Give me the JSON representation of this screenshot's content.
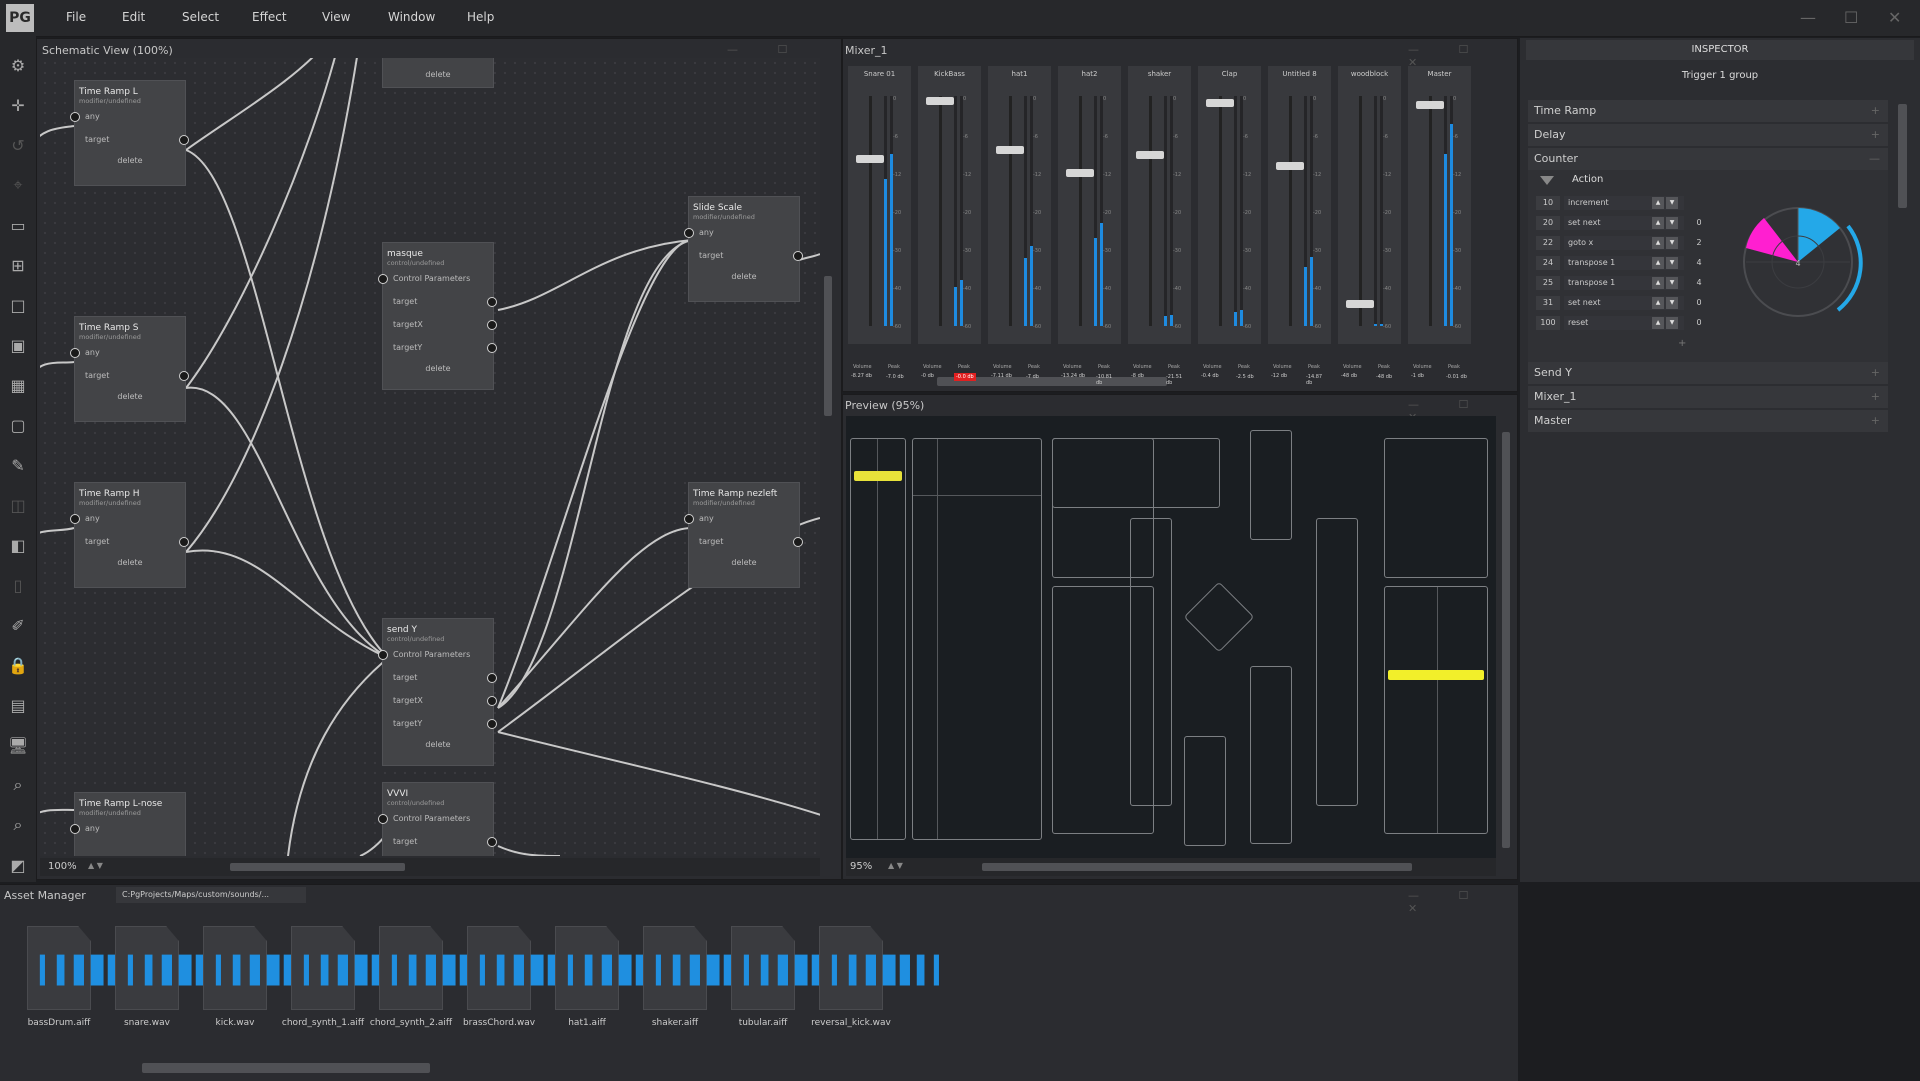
{
  "app": {
    "logo": "PG"
  },
  "menu": [
    "File",
    "Edit",
    "Select",
    "Effect",
    "View",
    "Window",
    "Help"
  ],
  "window_buttons": [
    "—",
    "☐",
    "✕"
  ],
  "toolbar_icons": [
    "gear-icon",
    "crosshair-icon",
    "undo-icon",
    "redo-icon",
    "folder-icon",
    "add-box-icon",
    "square-icon",
    "image-icon",
    "grid-icon",
    "frame-icon",
    "edit-icon",
    "layers-icon",
    "stack-icon",
    "phone-icon",
    "pen-icon",
    "lock-icon",
    "lock-box-icon",
    "monitor-icon",
    "zoom-in-icon",
    "zoom-out-icon",
    "layers-alt-icon"
  ],
  "schematic": {
    "title": "Schematic View (100%)",
    "zoom": "100%",
    "nodes": [
      {
        "id": "tr-l",
        "title": "Time Ramp L",
        "sub": "modifier/undefined",
        "ports": [
          "any",
          "target"
        ],
        "del": "delete"
      },
      {
        "id": "tr-s",
        "title": "Time Ramp S",
        "sub": "modifier/undefined",
        "ports": [
          "any",
          "target"
        ],
        "del": "delete"
      },
      {
        "id": "tr-h",
        "title": "Time Ramp H",
        "sub": "modifier/undefined",
        "ports": [
          "any",
          "target"
        ],
        "del": "delete"
      },
      {
        "id": "tr-lnose",
        "title": "Time Ramp L-nose",
        "sub": "modifier/undefined",
        "ports": [
          "any"
        ],
        "del": ""
      },
      {
        "id": "top",
        "title": "",
        "sub": "",
        "ports": [],
        "del": "delete"
      },
      {
        "id": "masque",
        "title": "masque",
        "sub": "control/undefined",
        "ports": [
          "Control Parameters",
          "target",
          "targetX",
          "targetY"
        ],
        "del": "delete"
      },
      {
        "id": "sendy",
        "title": "send Y",
        "sub": "control/undefined",
        "ports": [
          "Control Parameters",
          "target",
          "targetX",
          "targetY"
        ],
        "del": "delete"
      },
      {
        "id": "vvvi",
        "title": "VVVI",
        "sub": "control/undefined",
        "ports": [
          "Control Parameters",
          "target"
        ],
        "del": ""
      },
      {
        "id": "slide",
        "title": "Slide Scale",
        "sub": "modifier/undefined",
        "ports": [
          "any",
          "target"
        ],
        "del": "delete"
      },
      {
        "id": "trnez",
        "title": "Time Ramp nezleft",
        "sub": "modifier/undefined",
        "ports": [
          "any",
          "target"
        ],
        "del": "delete"
      }
    ]
  },
  "mixer": {
    "title": "Mixer_1",
    "scale": [
      "0",
      "-6",
      "-12",
      "-20",
      "-30",
      "-40",
      "-60"
    ],
    "label_volume": "Volume",
    "label_peak": "Peak",
    "strips": [
      {
        "name": "Snare 01",
        "vol": "-8.27 db",
        "peak": "-7.0 db",
        "fader": 0.28,
        "level": 0.75,
        "peak_red": false
      },
      {
        "name": "KickBass",
        "vol": "-0 db",
        "peak": "-0.0 db",
        "fader": 0.02,
        "level": 0.2,
        "peak_red": true
      },
      {
        "name": "hat1",
        "vol": "-7.11 db",
        "peak": "-7 db",
        "fader": 0.24,
        "level": 0.35,
        "peak_red": false
      },
      {
        "name": "hat2",
        "vol": "-13.24 db",
        "peak": "-10.81 db",
        "fader": 0.34,
        "level": 0.45,
        "peak_red": false
      },
      {
        "name": "shaker",
        "vol": "-8 db",
        "peak": "-21.51 db",
        "fader": 0.26,
        "level": 0.05,
        "peak_red": false
      },
      {
        "name": "Clap",
        "vol": "-0.4 db",
        "peak": "-2.5 db",
        "fader": 0.03,
        "level": 0.07,
        "peak_red": false
      },
      {
        "name": "Untitled 8",
        "vol": "-12 db",
        "peak": "-14.87 db",
        "fader": 0.31,
        "level": 0.3,
        "peak_red": false
      },
      {
        "name": "woodblock",
        "vol": "-48 db",
        "peak": "-48 db",
        "fader": 0.92,
        "level": 0.01,
        "peak_red": false
      },
      {
        "name": "Master",
        "vol": "-1 db",
        "peak": "-0.01 db",
        "fader": 0.04,
        "level": 0.88,
        "peak_red": false
      }
    ]
  },
  "preview": {
    "title": "Preview (95%)",
    "zoom": "95%"
  },
  "inspector": {
    "title": "INSPECTOR",
    "group": "Trigger 1 group",
    "sections": [
      "Time Ramp",
      "Delay",
      "Counter",
      "Send Y",
      "Mixer_1",
      "Master"
    ],
    "action_header": "Action",
    "actions": [
      {
        "n": "10",
        "a": "increment",
        "v": ""
      },
      {
        "n": "20",
        "a": "set next",
        "v": "0"
      },
      {
        "n": "22",
        "a": "goto x",
        "v": "2"
      },
      {
        "n": "24",
        "a": "transpose 1",
        "v": "4"
      },
      {
        "n": "25",
        "a": "transpose 1",
        "v": "4"
      },
      {
        "n": "31",
        "a": "set next",
        "v": "0"
      },
      {
        "n": "100",
        "a": "reset",
        "v": "0"
      }
    ],
    "dial_value": "4",
    "add": "+",
    "up": "▲",
    "down": "▼",
    "colors": {
      "magenta": "#ff1fd0",
      "blue": "#24a8e8"
    }
  },
  "assets": {
    "title": "Asset Manager",
    "path": "C:PgProjects/Maps/custom/sounds/...",
    "files": [
      "bassDrum.aiff",
      "snare.wav",
      "kick.wav",
      "chord_synth_1.aiff",
      "chord_synth_2.aiff",
      "brassChord.wav",
      "hat1.aiff",
      "shaker.aiff",
      "tubular.aiff",
      "reversal_kick.wav"
    ]
  }
}
